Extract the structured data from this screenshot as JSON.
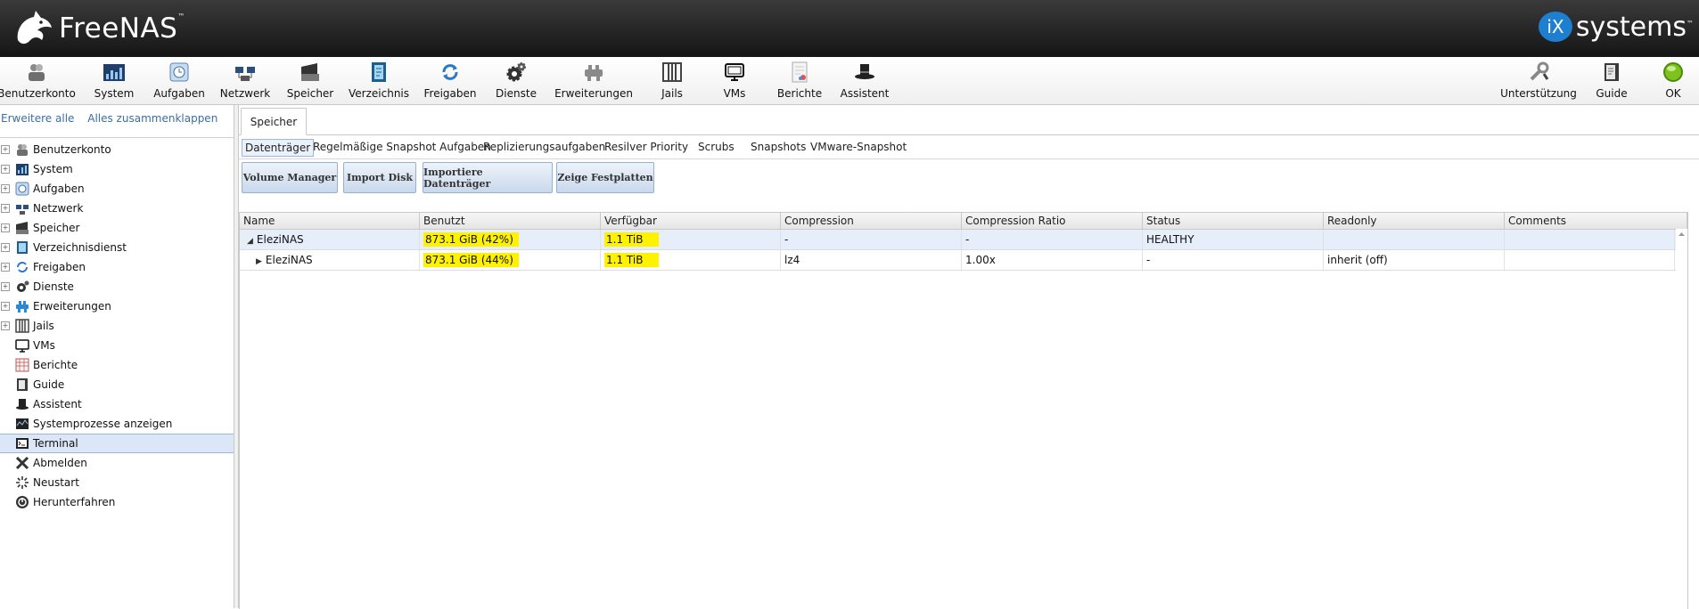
{
  "header": {
    "brand": "FreeNAS",
    "brand_mark": "™",
    "vendor_i": "iX",
    "vendor_text": "systems",
    "vendor_mark": "™"
  },
  "toolbar": {
    "items": [
      {
        "label": "Benutzerkonto",
        "icon": "users-icon"
      },
      {
        "label": "System",
        "icon": "system-chart-icon"
      },
      {
        "label": "Aufgaben",
        "icon": "tasks-clock-icon"
      },
      {
        "label": "Netzwerk",
        "icon": "network-icon"
      },
      {
        "label": "Speicher",
        "icon": "storage-icon"
      },
      {
        "label": "Verzeichnis",
        "icon": "directory-icon"
      },
      {
        "label": "Freigaben",
        "icon": "shares-icon"
      },
      {
        "label": "Dienste",
        "icon": "services-gears-icon"
      },
      {
        "label": "Erweiterungen",
        "icon": "plugins-icon"
      },
      {
        "label": "Jails",
        "icon": "jails-icon"
      },
      {
        "label": "VMs",
        "icon": "vms-monitor-icon"
      },
      {
        "label": "Berichte",
        "icon": "reports-icon"
      },
      {
        "label": "Assistent",
        "icon": "wizard-hat-icon"
      }
    ],
    "right_items": [
      {
        "label": "Unterstützung",
        "icon": "support-tools-icon"
      },
      {
        "label": "Guide",
        "icon": "guide-book-icon"
      },
      {
        "label": "OK",
        "icon": "alert-ok-icon"
      }
    ],
    "alert_color": "#7dc21e"
  },
  "left": {
    "expand_all": "Erweitere alle",
    "collapse_all": "Alles zusammenklappen",
    "tree": [
      {
        "label": "Benutzerkonto",
        "expandable": true,
        "icon": "users-icon"
      },
      {
        "label": "System",
        "expandable": true,
        "icon": "system-chart-icon"
      },
      {
        "label": "Aufgaben",
        "expandable": true,
        "icon": "tasks-clock-icon"
      },
      {
        "label": "Netzwerk",
        "expandable": true,
        "icon": "network-icon"
      },
      {
        "label": "Speicher",
        "expandable": true,
        "icon": "storage-icon"
      },
      {
        "label": "Verzeichnisdienst",
        "expandable": true,
        "icon": "directory-icon"
      },
      {
        "label": "Freigaben",
        "expandable": true,
        "icon": "shares-icon"
      },
      {
        "label": "Dienste",
        "expandable": true,
        "icon": "services-gears-icon"
      },
      {
        "label": "Erweiterungen",
        "expandable": true,
        "icon": "plugins-icon"
      },
      {
        "label": "Jails",
        "expandable": true,
        "icon": "jails-icon"
      },
      {
        "label": "VMs",
        "expandable": false,
        "icon": "vms-monitor-icon"
      },
      {
        "label": "Berichte",
        "expandable": false,
        "icon": "reports-icon"
      },
      {
        "label": "Guide",
        "expandable": false,
        "icon": "guide-book-icon"
      },
      {
        "label": "Assistent",
        "expandable": false,
        "icon": "wizard-hat-icon"
      },
      {
        "label": "Systemprozesse anzeigen",
        "expandable": false,
        "icon": "processes-icon"
      },
      {
        "label": "Terminal",
        "expandable": false,
        "icon": "terminal-icon",
        "selected": true
      },
      {
        "label": "Abmelden",
        "expandable": false,
        "icon": "logout-x-icon"
      },
      {
        "label": "Neustart",
        "expandable": false,
        "icon": "reboot-spinner-icon"
      },
      {
        "label": "Herunterfahren",
        "expandable": false,
        "icon": "shutdown-icon"
      }
    ]
  },
  "main": {
    "tab": "Speicher",
    "subtabs": [
      "Datenträger",
      "Regelmäßige Snapshot Aufgaben",
      "Replizierungsaufgaben",
      "Resilver Priority",
      "Scrubs",
      "Snapshots",
      "VMware-Snapshot"
    ],
    "active_subtab": "Datenträger",
    "buttons": [
      "Volume Manager",
      "Import Disk",
      "Importiere Datenträger",
      "Zeige Festplatten"
    ],
    "grid": {
      "columns": [
        "Name",
        "Benutzt",
        "Verfügbar",
        "Compression",
        "Compression Ratio",
        "Status",
        "Readonly",
        "Comments"
      ],
      "rows": [
        {
          "expanded": true,
          "name": "EleziNAS",
          "used": "873.1 GiB (42%)",
          "avail": "1.1 TiB",
          "compression": "-",
          "ratio": "-",
          "status": "HEALTHY",
          "readonly": "",
          "comments": ""
        },
        {
          "expanded": false,
          "name": "EleziNAS",
          "used": "873.1 GiB (44%)",
          "avail": "1.1 TiB",
          "compression": "lz4",
          "ratio": "1.00x",
          "status": "-",
          "readonly": "inherit (off)",
          "comments": ""
        }
      ]
    },
    "highlight_color": "#fff200"
  }
}
